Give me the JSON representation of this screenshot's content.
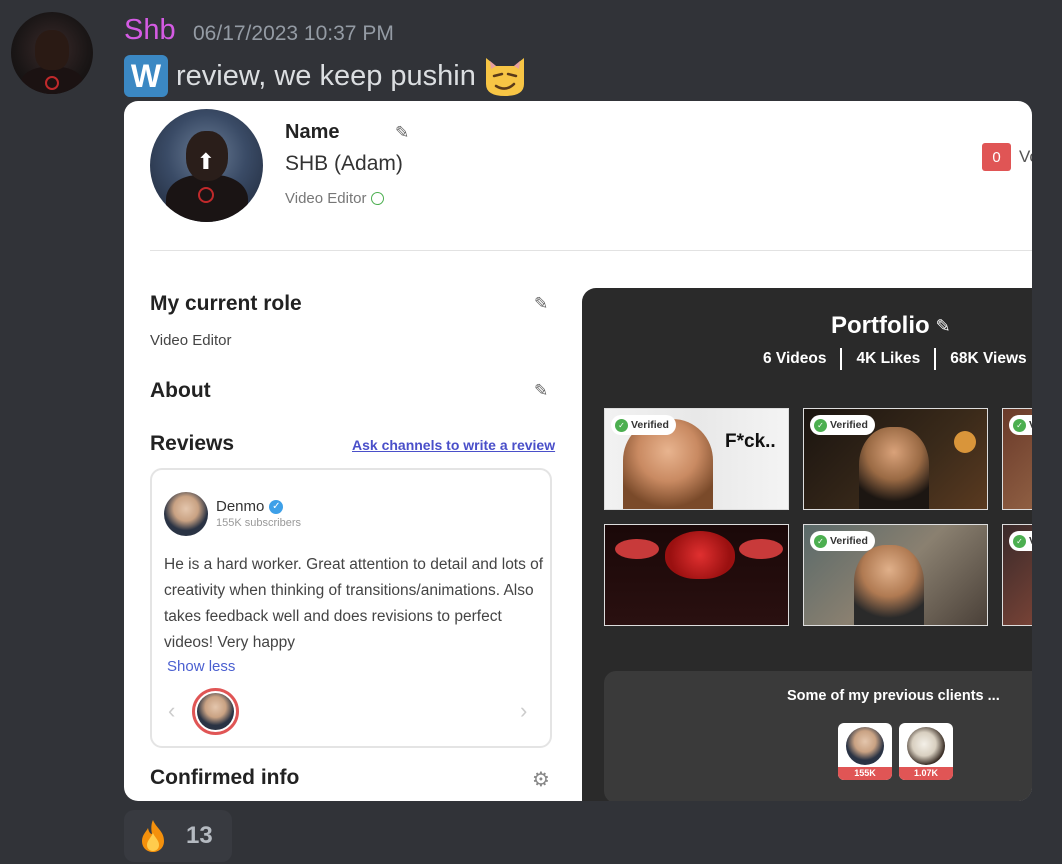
{
  "message": {
    "username": "Shb",
    "timestamp": "06/17/2023 10:37 PM",
    "w_badge": "W",
    "text": "review, we keep pushin",
    "emoji_icon": "smirking-cat-icon",
    "username_color": "#d45be3"
  },
  "profile": {
    "name_label": "Name",
    "name_value": "SHB (Adam)",
    "role": "Video Editor",
    "badge_count": "0",
    "badge_text": "Vo"
  },
  "sections": {
    "current_role_title": "My current role",
    "current_role_value": "Video Editor",
    "about_title": "About",
    "reviews_title": "Reviews",
    "ask_link": "Ask channels to write a review",
    "confirmed_title": "Confirmed info"
  },
  "review": {
    "author": "Denmo",
    "subscribers": "155K subscribers",
    "text": "He is a hard worker. Great attention to detail and lots of creativity when thinking of transitions/animations. Also takes feedback well and does revisions to perfect videos! Very happy",
    "show_less": "Show less"
  },
  "portfolio": {
    "title": "Portfolio",
    "videos": "6 Videos",
    "likes": "4K Likes",
    "views": "68K Views",
    "verified_label": "Verified",
    "thumb_text": "F*ck..",
    "clients_title": "Some of my previous clients ...",
    "clients": [
      {
        "count": "155K"
      },
      {
        "count": "1.07K"
      }
    ]
  },
  "reaction": {
    "emoji_icon": "fire-icon",
    "count": "13"
  }
}
